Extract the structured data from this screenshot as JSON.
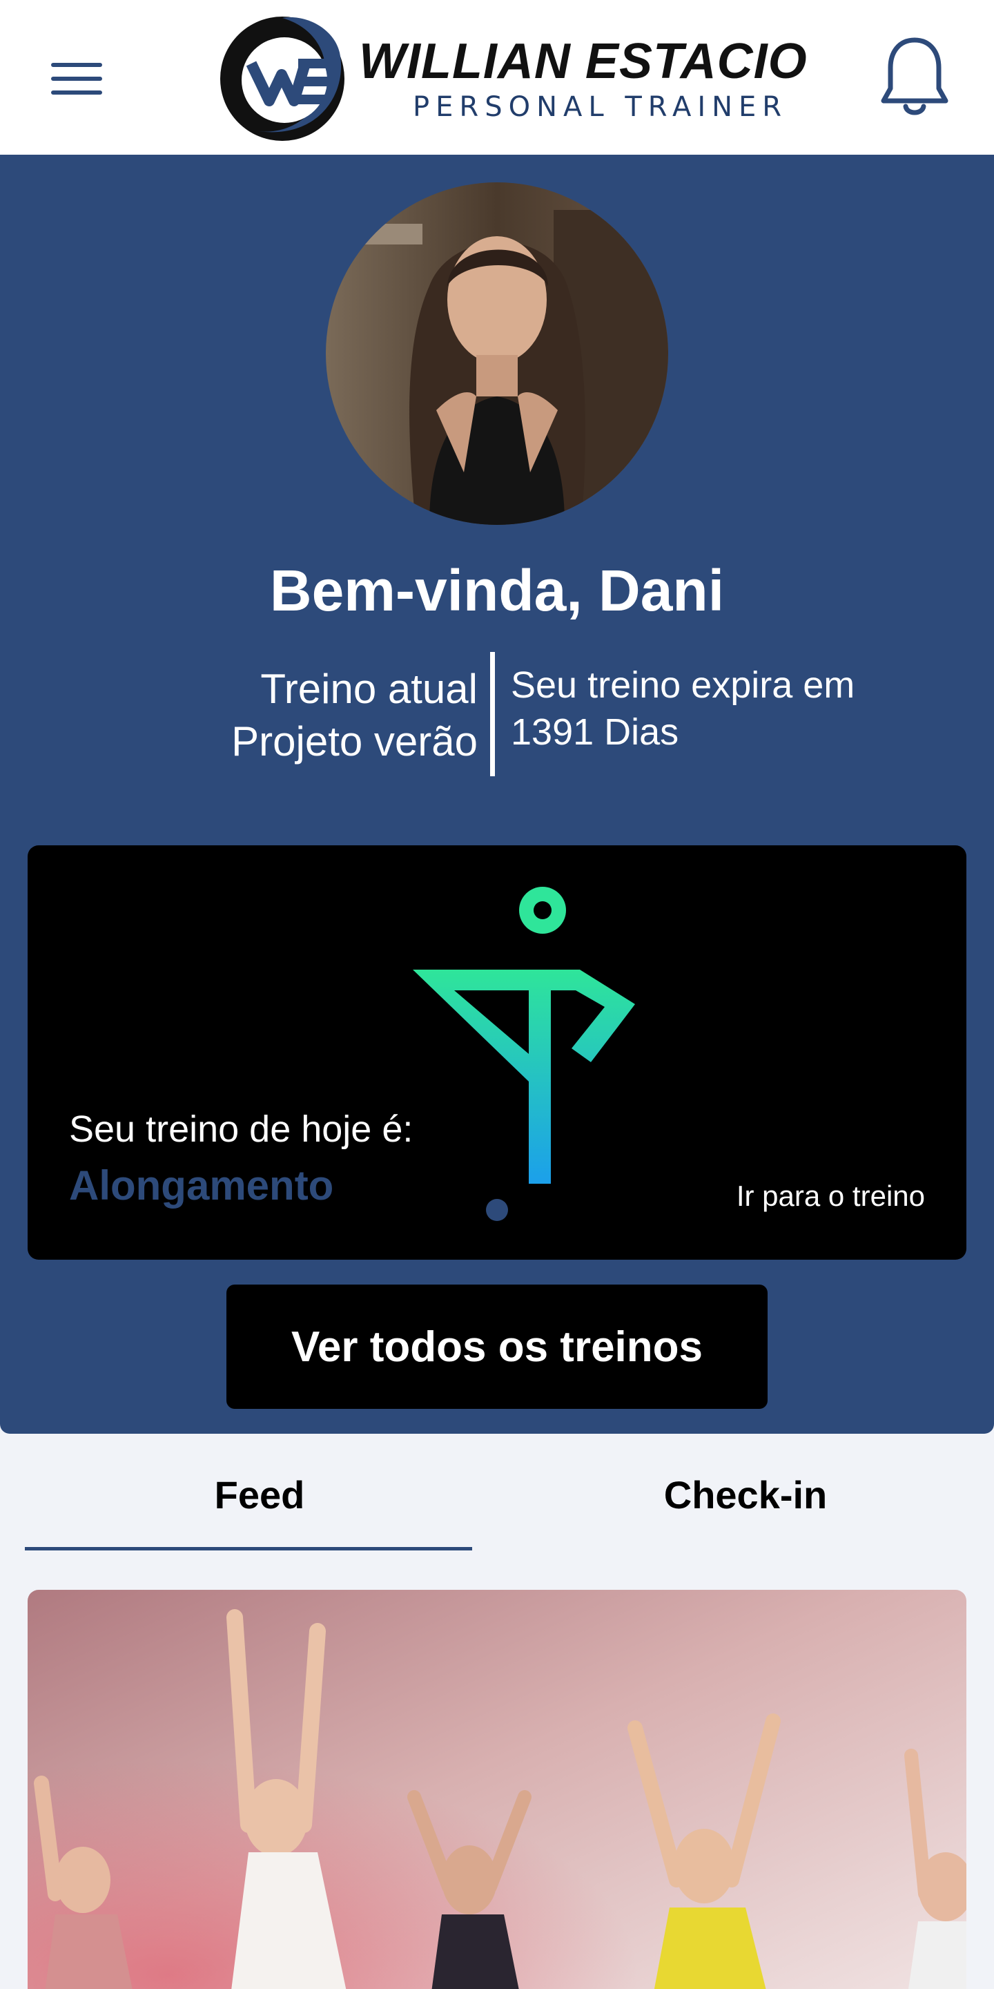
{
  "header": {
    "brand_name": "WILLIAN ESTACIO",
    "brand_subtitle": "PERSONAL TRAINER",
    "brand_initials": "WE",
    "menu_icon": "hamburger-menu-icon",
    "notification_icon": "bell-icon"
  },
  "profile": {
    "greeting": "Bem-vinda, Dani",
    "current_plan_label": "Treino atual",
    "current_plan_name": "Projeto verão",
    "expires_label": "Seu treino expira em",
    "expires_value": "1391 Dias"
  },
  "today_workout": {
    "label": "Seu treino de hoje é:",
    "name": "Alongamento",
    "link_label": "Ir para o treino",
    "icon": "stretching-figure-icon"
  },
  "actions": {
    "all_workouts_label": "Ver todos os treinos"
  },
  "tabs": [
    {
      "label": "Feed",
      "active": true
    },
    {
      "label": "Check-in",
      "active": false
    }
  ],
  "colors": {
    "primary": "#2d4a7a",
    "card_background": "#000000",
    "page_background": "#f1f3f8",
    "icon_gradient_top": "#2fe59a",
    "icon_gradient_bottom": "#1a9bf0"
  }
}
